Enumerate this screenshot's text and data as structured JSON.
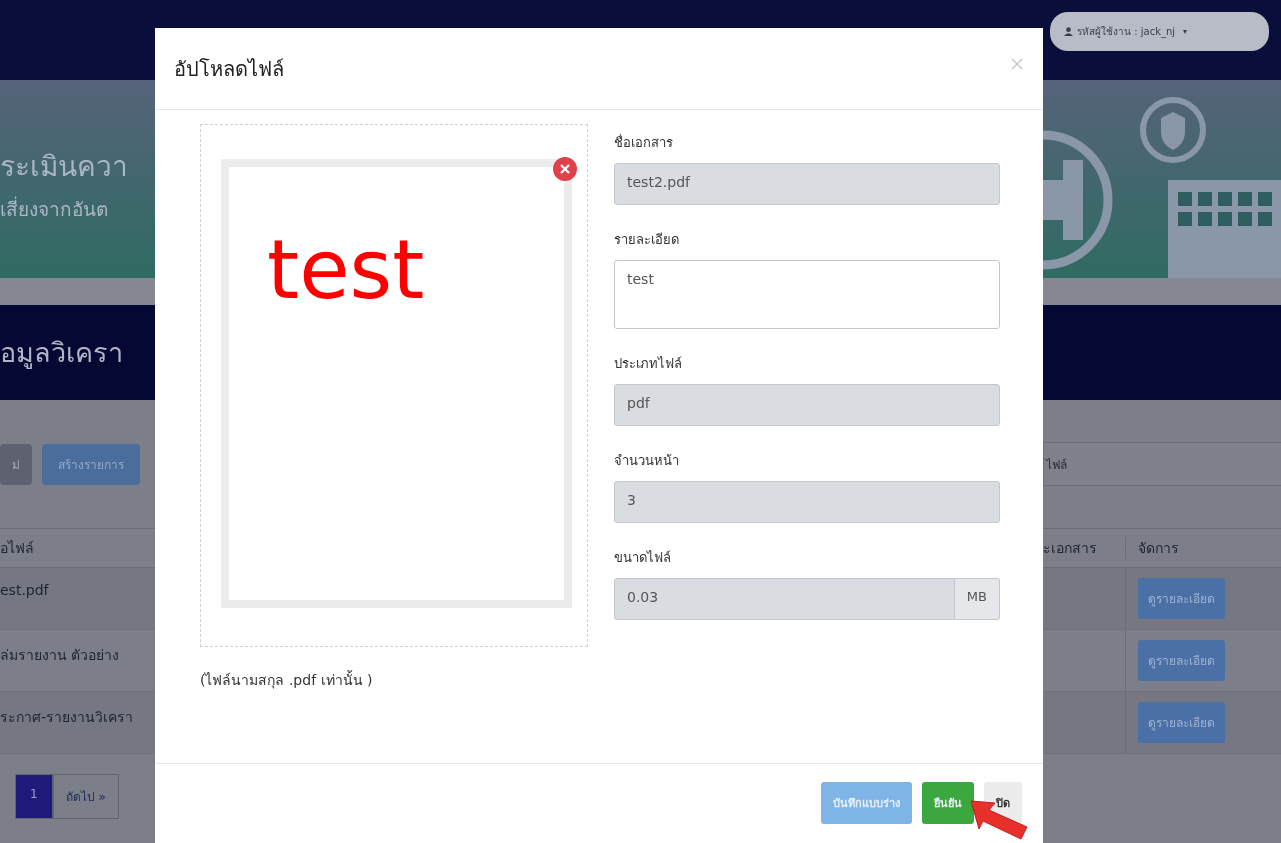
{
  "background_page": {
    "user_menu": {
      "label": "รหัสผู้ใช้งาน : jack_nj",
      "caret": "▾"
    },
    "banner_title": "ระเมินควา",
    "banner_subtitle": "เสี่ยงจากอันต",
    "section_title": "อมูลวิเครา",
    "toolbar_buttons": [
      {
        "label": "ม่",
        "kind": "secondary"
      },
      {
        "label": "สร้างรายการ",
        "kind": "primary"
      }
    ],
    "search_placeholder": "ไฟล์",
    "table": {
      "columns": [
        "อไฟล์",
        "ะเอกสาร",
        "จัดการ"
      ],
      "rows": [
        {
          "file": "est.pdf",
          "action": "ดูรายละเอียด"
        },
        {
          "file": "ล่มรายงาน ตัวอย่าง",
          "action": "ดูรายละเอียด"
        },
        {
          "file": "ระกาศ-รายงานวิเครา",
          "action": "ดูรายละเอียด"
        }
      ]
    },
    "pagination": [
      {
        "label": "1",
        "selected": true
      },
      {
        "label": "ถัดไป »",
        "selected": false
      }
    ]
  },
  "modal": {
    "title": "อัปโหลดไฟล์",
    "preview_text": "test",
    "hint": "(ไฟล์นามสกุล .pdf เท่านั้น )",
    "fields": [
      {
        "label": "ชื่อเอกสาร",
        "kind": "input",
        "value": "test2.pdf",
        "disabled": true
      },
      {
        "label": "รายละเอียด",
        "kind": "textarea",
        "value": "test",
        "disabled": false
      },
      {
        "label": "ประเภทไฟล์",
        "kind": "input",
        "value": "pdf",
        "disabled": true
      },
      {
        "label": "จำนวนหน้า",
        "kind": "input",
        "value": "3",
        "disabled": true
      },
      {
        "label": "ขนาดไฟล์",
        "kind": "input_group",
        "value": "0.03",
        "addon": "MB",
        "disabled": true
      }
    ],
    "buttons": [
      {
        "label": "บันทึกแบบร่าง",
        "kind": "draft"
      },
      {
        "label": "ยืนยัน",
        "kind": "confirm"
      },
      {
        "label": "ปิด",
        "kind": "close"
      }
    ]
  }
}
